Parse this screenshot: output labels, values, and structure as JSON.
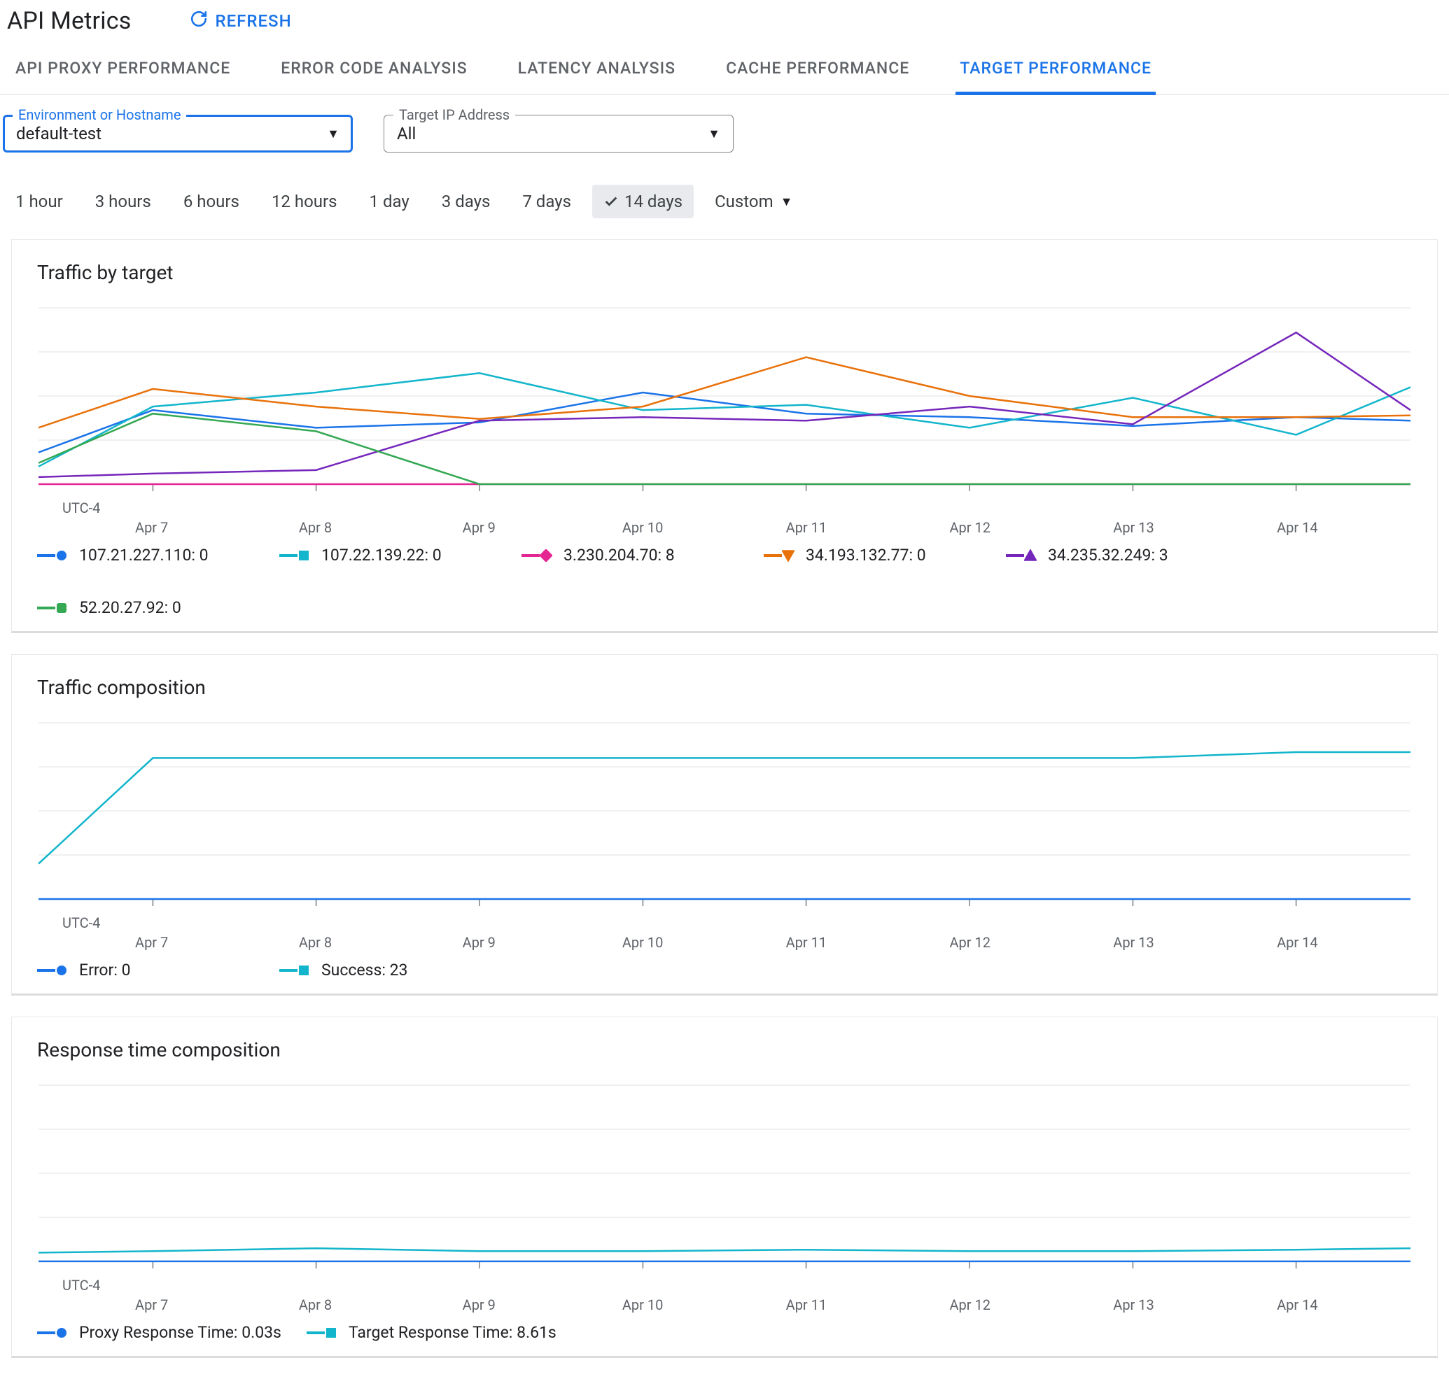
{
  "page": {
    "title": "API Metrics"
  },
  "buttons": {
    "refresh": "REFRESH"
  },
  "tabs": [
    {
      "id": "api-proxy-performance",
      "label": "API PROXY PERFORMANCE",
      "active": false
    },
    {
      "id": "error-code-analysis",
      "label": "ERROR CODE ANALYSIS",
      "active": false
    },
    {
      "id": "latency-analysis",
      "label": "LATENCY ANALYSIS",
      "active": false
    },
    {
      "id": "cache-performance",
      "label": "CACHE PERFORMANCE",
      "active": false
    },
    {
      "id": "target-performance",
      "label": "TARGET PERFORMANCE",
      "active": true
    }
  ],
  "filters": {
    "env": {
      "label": "Environment or Hostname",
      "value": "default-test"
    },
    "target": {
      "label": "Target IP Address",
      "value": "All"
    }
  },
  "time_chips": {
    "options": [
      "1 hour",
      "3 hours",
      "6 hours",
      "12 hours",
      "1 day",
      "3 days",
      "7 days",
      "14 days"
    ],
    "selected": "14 days",
    "custom_label": "Custom"
  },
  "shared": {
    "timezone": "UTC-4",
    "x_categories": [
      "Apr 7",
      "Apr 8",
      "Apr 9",
      "Apr 10",
      "Apr 11",
      "Apr 12",
      "Apr 13",
      "Apr 14"
    ]
  },
  "colors": {
    "blue": "#1a73e8",
    "teal": "#12b5cb",
    "pink": "#e52592",
    "orange": "#e8710a",
    "purple": "#7627bb",
    "green": "#34a853",
    "grid": "#e0e0e0",
    "axis": "#9aa0a6"
  },
  "cards": {
    "traffic_by_target": {
      "title": "Traffic by target"
    },
    "traffic_composition": {
      "title": "Traffic composition"
    },
    "response_time_composition": {
      "title": "Response time composition"
    }
  },
  "chart_data": [
    {
      "id": "traffic_by_target",
      "type": "line",
      "title": "Traffic by target",
      "xlabel": "",
      "ylabel": "",
      "ylim": [
        0,
        10
      ],
      "x": [
        6.3,
        7,
        8,
        9,
        10,
        11,
        12,
        13,
        14,
        14.7
      ],
      "x_tick_labels": [
        "Apr 7",
        "Apr 8",
        "Apr 9",
        "Apr 10",
        "Apr 11",
        "Apr 12",
        "Apr 13",
        "Apr 14"
      ],
      "series": [
        {
          "name": "107.21.227.110",
          "current": "0",
          "color": "#1a73e8",
          "marker": "circle",
          "values": [
            1.8,
            4.2,
            3.2,
            3.5,
            5.2,
            4.0,
            3.8,
            3.3,
            3.8,
            3.6
          ]
        },
        {
          "name": "107.22.139.22",
          "current": "0",
          "color": "#12b5cb",
          "marker": "square",
          "values": [
            1.0,
            4.4,
            5.2,
            6.3,
            4.2,
            4.5,
            3.2,
            4.9,
            2.8,
            5.5
          ]
        },
        {
          "name": "3.230.204.70",
          "current": "8",
          "color": "#e52592",
          "marker": "diamond",
          "values": [
            0,
            0,
            0,
            0,
            0,
            0,
            0,
            0,
            0,
            0
          ]
        },
        {
          "name": "34.193.132.77",
          "current": "0",
          "color": "#e8710a",
          "marker": "triangle-down",
          "values": [
            3.2,
            5.4,
            4.4,
            3.7,
            4.4,
            7.2,
            5.0,
            3.8,
            3.8,
            3.9
          ]
        },
        {
          "name": "34.235.32.249",
          "current": "3",
          "color": "#7627bb",
          "marker": "triangle-up",
          "values": [
            0.4,
            0.6,
            0.8,
            3.6,
            3.8,
            3.6,
            4.4,
            3.4,
            8.6,
            4.2
          ]
        },
        {
          "name": "52.20.27.92",
          "current": "0",
          "color": "#34a853",
          "marker": "rounded-square",
          "values": [
            1.2,
            4.0,
            3.0,
            0,
            0,
            0,
            0,
            0,
            0,
            0
          ]
        }
      ]
    },
    {
      "id": "traffic_composition",
      "type": "line",
      "title": "Traffic composition",
      "xlabel": "",
      "ylabel": "",
      "ylim": [
        0,
        30
      ],
      "x": [
        6.3,
        7,
        8,
        9,
        10,
        11,
        12,
        13,
        14,
        14.7
      ],
      "x_tick_labels": [
        "Apr 7",
        "Apr 8",
        "Apr 9",
        "Apr 10",
        "Apr 11",
        "Apr 12",
        "Apr 13",
        "Apr 14"
      ],
      "series": [
        {
          "name": "Error",
          "current": "0",
          "color": "#1a73e8",
          "marker": "circle",
          "values": [
            0,
            0,
            0,
            0,
            0,
            0,
            0,
            0,
            0,
            0
          ]
        },
        {
          "name": "Success",
          "current": "23",
          "color": "#12b5cb",
          "marker": "square",
          "values": [
            6,
            24,
            24,
            24,
            24,
            24,
            24,
            24,
            25,
            25
          ]
        }
      ]
    },
    {
      "id": "response_time_composition",
      "type": "line",
      "title": "Response time composition",
      "xlabel": "",
      "ylabel": "",
      "ylim": [
        0,
        120
      ],
      "x": [
        6.3,
        7,
        8,
        9,
        10,
        11,
        12,
        13,
        14,
        14.7
      ],
      "x_tick_labels": [
        "Apr 7",
        "Apr 8",
        "Apr 9",
        "Apr 10",
        "Apr 11",
        "Apr 12",
        "Apr 13",
        "Apr 14"
      ],
      "series": [
        {
          "name": "Proxy Response Time",
          "current": "0.03s",
          "color": "#1a73e8",
          "marker": "circle",
          "values": [
            0.03,
            0.03,
            0.03,
            0.03,
            0.03,
            0.03,
            0.03,
            0.03,
            0.03,
            0.03
          ]
        },
        {
          "name": "Target Response Time",
          "current": "8.61s",
          "color": "#12b5cb",
          "marker": "square",
          "values": [
            6,
            7,
            9,
            7,
            7,
            8,
            7,
            7,
            8,
            9
          ]
        }
      ]
    }
  ]
}
